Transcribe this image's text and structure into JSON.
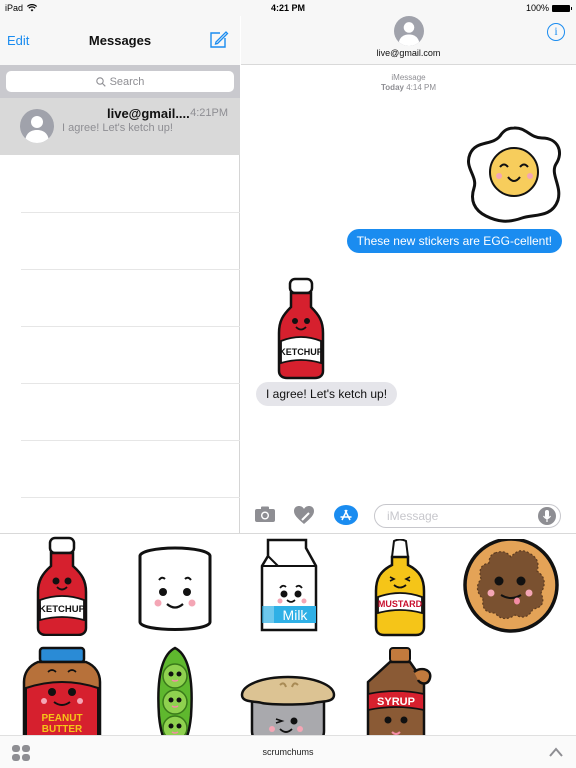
{
  "status_bar": {
    "device": "iPad",
    "time": "4:21 PM",
    "battery": "100%"
  },
  "left_pane": {
    "edit_label": "Edit",
    "title": "Messages",
    "search_placeholder": "Search",
    "conversations": [
      {
        "name": "live@gmail....",
        "time": "4:21PM",
        "preview": "I agree! Let's ketch up!",
        "selected": true
      }
    ]
  },
  "conversation": {
    "contact": "live@gmail.com",
    "service": "iMessage",
    "timestamp_day": "Today",
    "timestamp_time": "4:14 PM",
    "messages": [
      {
        "direction": "outgoing",
        "type": "sticker",
        "sticker": "fried-egg"
      },
      {
        "direction": "outgoing",
        "type": "text",
        "text": "These new stickers are EGG-cellent!"
      },
      {
        "direction": "incoming",
        "type": "sticker",
        "sticker": "ketchup-bottle"
      },
      {
        "direction": "incoming",
        "type": "text",
        "text": "I agree! Let's ketch up!"
      }
    ],
    "input_placeholder": "iMessage"
  },
  "colors": {
    "accent": "#1a8cf0",
    "incoming_bubble": "#e5e5ea",
    "selected_row": "#d9d9d9"
  },
  "sticker_drawer": {
    "pack_name": "scrumchums",
    "stickers": [
      {
        "name": "ketchup",
        "label": "KETCHUP"
      },
      {
        "name": "marshmallow",
        "label": ""
      },
      {
        "name": "milk",
        "label": "Milk"
      },
      {
        "name": "mustard",
        "label": "MUSTARD"
      },
      {
        "name": "chocolate-pancake",
        "label": ""
      },
      {
        "name": "peanut-butter",
        "label": "PEANUT BUTTER"
      },
      {
        "name": "peas",
        "label": ""
      },
      {
        "name": "pie",
        "label": ""
      },
      {
        "name": "syrup",
        "label": "SYRUP"
      }
    ]
  }
}
